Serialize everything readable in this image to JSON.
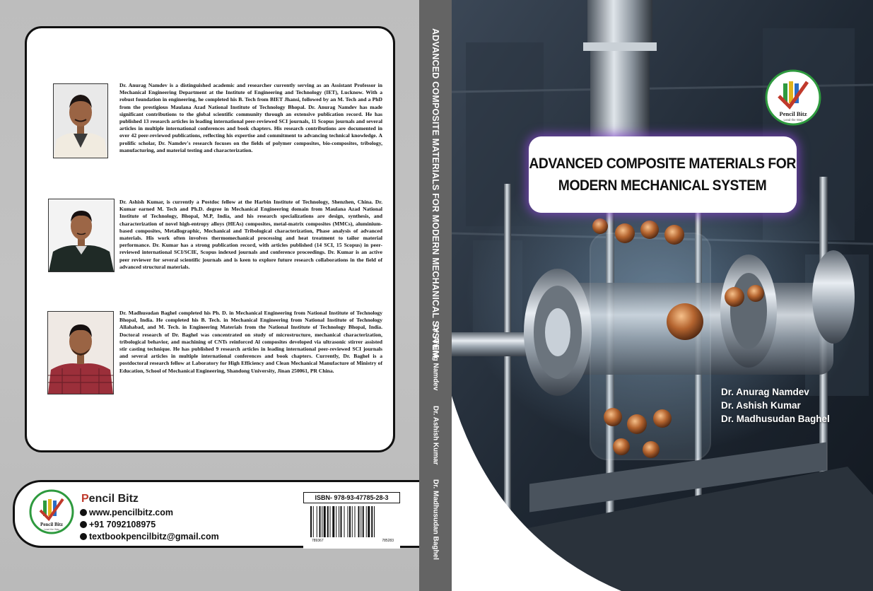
{
  "book": {
    "title_line1": "ADVANCED COMPOSITE MATERIALS FOR",
    "title_line2": "MODERN MECHANICAL SYSTEM",
    "spine_title": "ADVANCED COMPOSITE MATERIALS FOR MODERN MECHANICAL SYSTEM",
    "authors": [
      "Dr. Anurag Namdev",
      "Dr. Ashish Kumar",
      "Dr. Madhusudan Baghel"
    ]
  },
  "bios": [
    "Dr. Anurag Namdev is a distinguished academic and researcher currently serving as an Assistant Professor in Mechanical Engineering Department at the Institute of Engineering and Technology (IET), Lucknow. With a robust foundation in engineering, he completed his B. Tech from BIET Jhansi, followed by an M. Tech and a PhD from the prestigious Maulana Azad National Institute of Technology Bhopal. Dr. Anurag Namdev has made significant contributions to the global scientific community through an extensive publication record. He has published 13 research articles in leading international peer-reviewed SCI journals, 11 Scopus journals and several articles in multiple international conferences and book chapters. His research contributions are documented in over 42 peer-reviewed publications, reflecting his expertise and commitment to advancing technical knowledge. A prolific scholar, Dr. Namdev's research focuses on the fields of polymer composites, bio-composites, tribology, manufacturing, and material testing and characterization.",
    "Dr. Ashish Kumar, is currently a Postdoc fellow at the Harbin Institute of Technology, Shenzhen, China. Dr. Kumar earned M. Tech and Ph.D. degree in Mechanical Engineering domain from Maulana Azad National Institute of Technology, Bhopal, M.P, India, and his research specializations are design, synthesis, and characterization of novel high-entropy alloys (HEAs) composites, metal-matrix composites (MMCs), aluminium-based composites, Metallographic, Mechanical and Tribological characterization, Phase analysis of advanced materials. His work often involves thermomechanical processing and heat treatment to tailor material performance. Dr. Kumar has a strong publication record, with articles published (14 SCI, 15 Scopus) in peer-reviewed international SCI/SCIE, Scopus indexed journals and conference proceedings. Dr. Kumar is an active peer reviewer for several scientific journals and is keen to explore future research collaborations in the field of advanced structural materials.",
    "Dr. Madhusudan Baghel completed his Ph. D. in Mechanical Engineering from National Institute of Technology Bhopal, India. He completed his B. Tech. in Mechanical Engineering from National Institute of Technology Allahabad, and M. Tech. in Engineering Materials from the National Institute of Technology Bhopal, India. Doctoral research of Dr. Baghel was concentrated on study of microstructure, mechanical characterization, tribological behavior, and machining of CNTs reinforced Al composites developed via ultrasonic stirrer assisted stir casting technique. He has published 9 research articles in leading international peer-reviewed SCI journals and several articles in multiple international conferences and book chapters. Currently, Dr. Baghel is a postdoctoral research fellow at Laboratory for High Efficiency and Clean Mechanical Manufacture of Ministry of Education, School of Mechanical Engineering, Shandong University, Jinan 250061, PR China."
  ],
  "publisher": {
    "name_first": "P",
    "name_rest": "encil Bitz",
    "website": "www.pencilbitz.com",
    "phone": "+91 7092108975",
    "email": "textbookpencilbitz@gmail.com",
    "logo_text": "Pencil Bitz",
    "logo_tagline": "Lead the Way"
  },
  "isbn": {
    "label": "ISBN- 978-93-47785-28-3",
    "digits_left": "789367",
    "digits_right": "785283"
  },
  "colors": {
    "spine": "#646464",
    "back_bg": "#bfbfbf",
    "title_glow": "#8246c8",
    "logo_green": "#2e9a3e",
    "logo_red": "#c0392b"
  }
}
